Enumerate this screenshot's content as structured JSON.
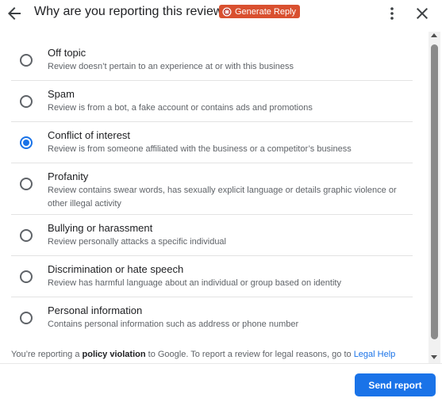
{
  "header": {
    "title": "Why are you reporting this review?",
    "generate_reply": "Generate Reply",
    "icons": {
      "back": "arrow-back-icon",
      "generate": "generate-reply-icon",
      "more": "more-vert-icon",
      "close": "close-icon"
    }
  },
  "options": [
    {
      "title": "Off topic",
      "description": "Review doesn’t pertain to an experience at or with this business",
      "checked": false
    },
    {
      "title": "Spam",
      "description": "Review is from a bot, a fake account or contains ads and promotions",
      "checked": false
    },
    {
      "title": "Conflict of interest",
      "description": "Review is from someone affiliated with the business or a competitor’s business",
      "checked": true
    },
    {
      "title": "Profanity",
      "description": "Review contains swear words, has sexually explicit language or details graphic violence or other illegal activity",
      "checked": false
    },
    {
      "title": "Bullying or harassment",
      "description": "Review personally attacks a specific individual",
      "checked": false
    },
    {
      "title": "Discrimination or hate speech",
      "description": "Review has harmful language about an individual or group based on identity",
      "checked": false
    },
    {
      "title": "Personal information",
      "description": "Contains personal information such as address or phone number",
      "checked": false
    }
  ],
  "footer": {
    "note_prefix": "You’re reporting a ",
    "note_bold": "policy violation",
    "note_suffix": " to Google. To report a review for legal reasons, go to ",
    "legal_link": "Legal Help",
    "send_button": "Send report"
  },
  "colors": {
    "accent": "#1a73e8",
    "generate_reply_bg": "#d9502f"
  }
}
